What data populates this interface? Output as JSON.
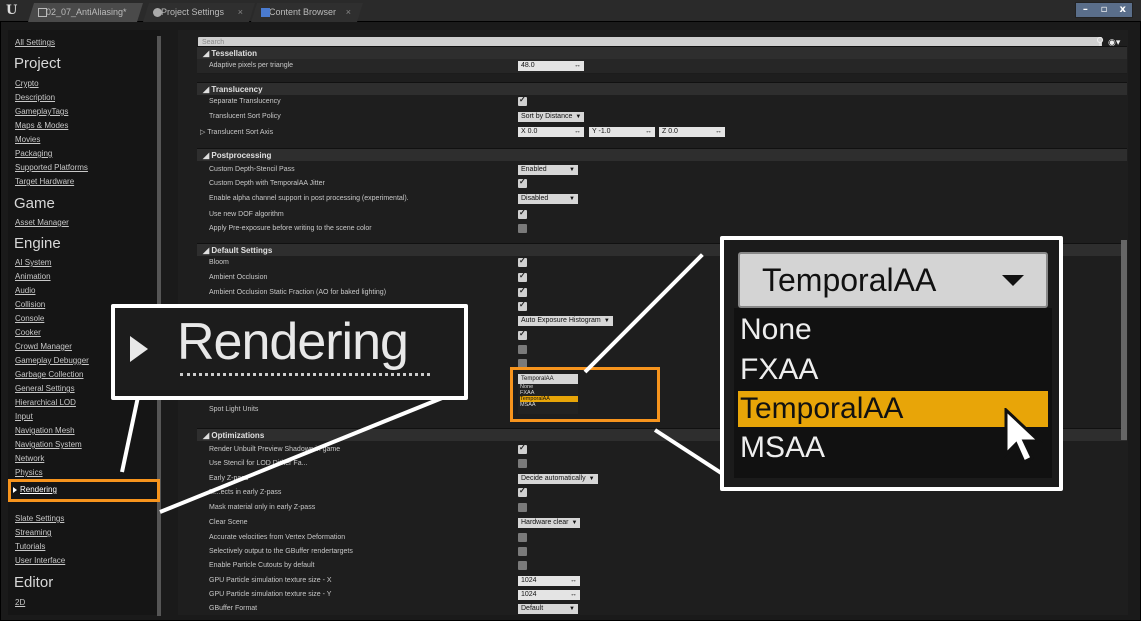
{
  "tabs": [
    {
      "label": "02_07_AntiAliasing*"
    },
    {
      "label": "Project Settings"
    },
    {
      "label": "Content Browser"
    }
  ],
  "window": {
    "minimize": "–",
    "maximize": "▫",
    "close": "x"
  },
  "sidebar": {
    "all_settings": "All Settings",
    "project_head": "Project",
    "project": [
      "Crypto",
      "Description",
      "GameplayTags",
      "Maps & Modes",
      "Movies",
      "Packaging",
      "Supported Platforms",
      "Target Hardware"
    ],
    "game_head": "Game",
    "game": [
      "Asset Manager"
    ],
    "engine_head": "Engine",
    "engine": [
      "AI System",
      "Animation",
      "Audio",
      "Collision",
      "Console",
      "Cooker",
      "Crowd Manager",
      "Gameplay Debugger",
      "Garbage Collection",
      "General Settings",
      "Hierarchical LOD",
      "Input",
      "Navigation Mesh",
      "Navigation System",
      "Network",
      "Physics"
    ],
    "selected": "Rendering",
    "engine_after": [
      "Slate Settings",
      "Streaming",
      "Tutorials",
      "User Interface"
    ],
    "editor_head": "Editor",
    "editor": [
      "2D"
    ]
  },
  "search": {
    "placeholder": "Search"
  },
  "sections": {
    "tessellation": "◢ Tessellation",
    "translucency": "◢ Translucency",
    "postprocessing": "◢ Postprocessing",
    "default_settings": "◢ Default Settings",
    "optimizations": "◢ Optimizations"
  },
  "rows": {
    "adaptive": {
      "label": "Adaptive pixels per triangle",
      "value": "48.0"
    },
    "sep_trans": {
      "label": "Separate Translucency"
    },
    "sort_policy": {
      "label": "Translucent Sort Policy",
      "value": "Sort by Distance"
    },
    "sort_axis": {
      "label": "▷ Translucent Sort Axis",
      "x": "X  0.0",
      "y": "Y  -1.0",
      "z": "Z  0.0"
    },
    "depth_stencil": {
      "label": "Custom Depth-Stencil Pass",
      "value": "Enabled"
    },
    "depth_taa": {
      "label": "Custom Depth with TemporalAA Jitter"
    },
    "alpha_pp": {
      "label": "Enable alpha channel support in post processing (experimental).",
      "value": "Disabled"
    },
    "dof": {
      "label": "Use new DOF algorithm"
    },
    "preexposure": {
      "label": "Apply Pre-exposure before writing to the scene color"
    },
    "bloom": {
      "label": "Bloom"
    },
    "ao": {
      "label": "Ambient Occlusion"
    },
    "ao_static": {
      "label": "Ambient Occlusion Static Fraction (AO for baked lighting)"
    },
    "auto_exposure": {
      "value": "Auto Exposure Histogram"
    },
    "spot_units": {
      "label": "Spot Light Units"
    },
    "unbuilt_shadows": {
      "label": "Render Unbuilt Preview Shadows in game"
    },
    "stencil_lod": {
      "label": "Use Stencil for LOD Dither Fa..."
    },
    "early_z": {
      "label": "Early Z-pass",
      "value": "Decide automatically"
    },
    "masked_early": {
      "label": "M...ects in early Z-pass"
    },
    "mask_mat": {
      "label": "Mask material only in early Z-pass"
    },
    "clear_scene": {
      "label": "Clear Scene",
      "value": "Hardware clear"
    },
    "vel_vertex": {
      "label": "Accurate velocities from Vertex Deformation"
    },
    "gbuffer_rt": {
      "label": "Selectively output to the GBuffer rendertargets"
    },
    "particle_cut": {
      "label": "Enable Particle Cutouts by default"
    },
    "gpu_x": {
      "label": "GPU Particle simulation texture size - X",
      "value": "1024"
    },
    "gpu_y": {
      "label": "GPU Particle simulation texture size - Y",
      "value": "1024"
    },
    "gbuffer_fmt": {
      "label": "GBuffer Format",
      "value": "Default"
    }
  },
  "aa_dropdown": {
    "selected": "TemporalAA",
    "options": [
      "None",
      "FXAA",
      "TemporalAA",
      "MSAA"
    ]
  },
  "callout_rendering": {
    "label": "Rendering"
  },
  "colors": {
    "highlight": "#f7941d",
    "selected_option": "#e8a508"
  }
}
